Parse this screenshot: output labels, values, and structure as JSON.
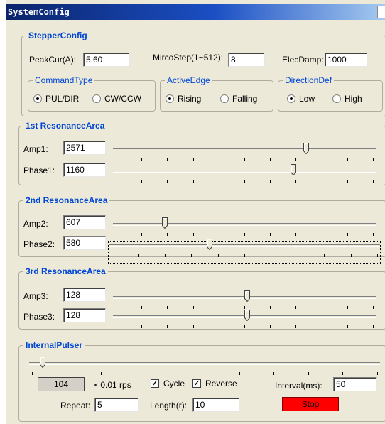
{
  "window": {
    "title": "SystemConfig"
  },
  "stepper": {
    "title": "StepperConfig",
    "peak_cur_label": "PeakCur(A):",
    "peak_cur_value": "5.60",
    "microstep_label": "MircoStep(1~512):",
    "microstep_value": "8",
    "elecdamp_label": "ElecDamp:",
    "elecdamp_value": "1000",
    "command_type": {
      "title": "CommandType",
      "opt1": "PUL/DIR",
      "opt2": "CW/CCW",
      "selected": "PUL/DIR"
    },
    "active_edge": {
      "title": "ActiveEdge",
      "opt1": "Rising",
      "opt2": "Falling",
      "selected": "Rising"
    },
    "direction_def": {
      "title": "DirectionDef",
      "opt1": "Low",
      "opt2": "High",
      "selected": "Low"
    }
  },
  "res1": {
    "title": "1st ResonanceArea",
    "amp_label": "Amp1:",
    "amp_value": "2571",
    "amp_level": 0.74,
    "phase_label": "Phase1:",
    "phase_value": "1160",
    "phase_level": 0.69
  },
  "res2": {
    "title": "2nd ResonanceArea",
    "amp_label": "Amp2:",
    "amp_value": "607",
    "amp_level": 0.19,
    "phase_label": "Phase2:",
    "phase_value": "580",
    "phase_level": 0.37
  },
  "res3": {
    "title": "3rd ResonanceArea",
    "amp_label": "Amp3:",
    "amp_value": "128",
    "amp_level": 0.51,
    "phase_label": "Phase3:",
    "phase_value": "128",
    "phase_level": 0.51
  },
  "pulser": {
    "title": "InternalPulser",
    "slider_level": 0.03,
    "speed_value": "104",
    "speed_unit": "× 0.01 rps",
    "cycle_label": "Cycle",
    "cycle_checked": true,
    "reverse_label": "Reverse",
    "reverse_checked": true,
    "interval_label": "Interval(ms):",
    "interval_value": "50",
    "repeat_label": "Repeat:",
    "repeat_value": "5",
    "length_label": "Length(r):",
    "length_value": "10",
    "stop_label": "Stop"
  }
}
